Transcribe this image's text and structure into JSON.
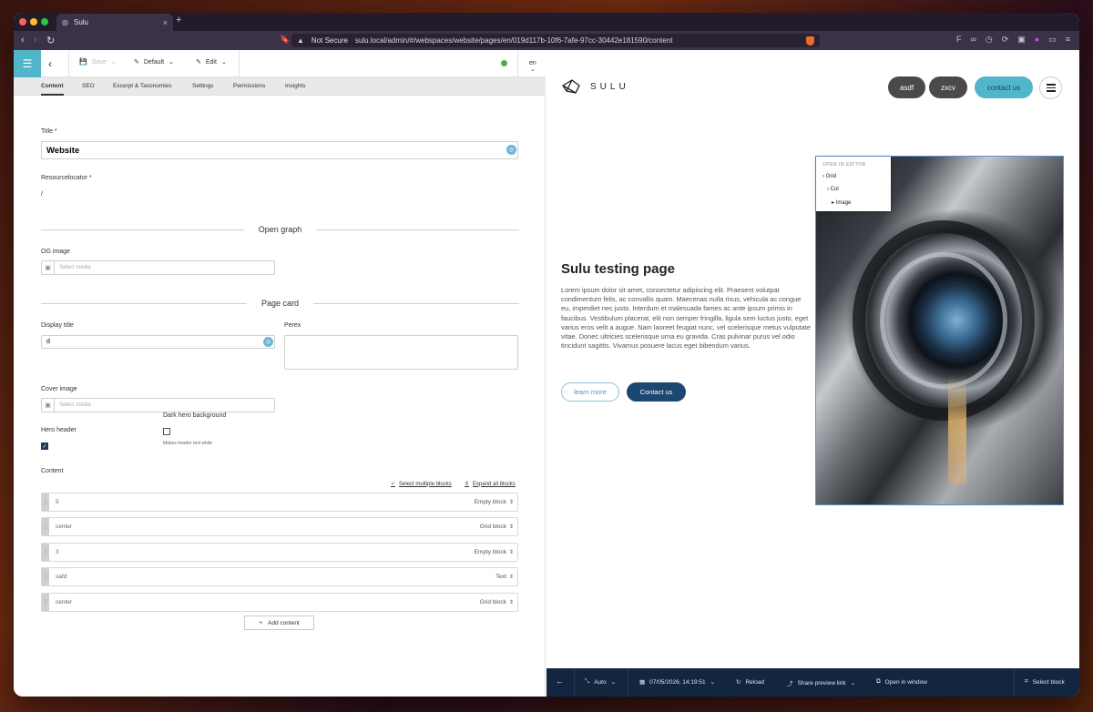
{
  "browser": {
    "tab_title": "Sulu",
    "not_secure": "Not Secure",
    "url": "sulu.local/admin/#/webspaces/website/pages/en/019d117b-10f6-7afe-97cc-30442e181590/content",
    "traffic_colors": [
      "#fe5f57",
      "#febc2e",
      "#28c840"
    ]
  },
  "toolbar": {
    "save_label": "Save",
    "template_label": "Default",
    "edit_label": "Edit",
    "locale": "en"
  },
  "tabs": [
    "Content",
    "SEO",
    "Excerpt & Taxonomies",
    "Settings",
    "Permissions",
    "Insights"
  ],
  "form": {
    "title_label": "Title *",
    "title_value": "Website",
    "resourcelocator_label": "Resourcelocator *",
    "resourcelocator_value": "/",
    "open_graph_title": "Open graph",
    "og_image_label": "OG image",
    "select_media": "Select media",
    "page_card_title": "Page card",
    "display_title_label": "Display title",
    "display_title_value": "d",
    "perex_label": "Perex",
    "cover_image_label": "Cover image",
    "dark_hero_label": "Dark hero background",
    "dark_hero_hint": "Makes header text white",
    "hero_header_label": "Hero header",
    "content_label": "Content",
    "select_multiple": "Select multiple blocks",
    "expand_all": "Expand all blocks",
    "add_content": "Add content",
    "blocks": [
      {
        "name": "5",
        "type": "Empty block"
      },
      {
        "name": "center",
        "type": "Grid block"
      },
      {
        "name": "3",
        "type": "Empty block"
      },
      {
        "name": "safd",
        "type": "Text"
      },
      {
        "name": "center",
        "type": "Grid block"
      }
    ]
  },
  "preview": {
    "logo_text": "SULU",
    "nav_buttons": [
      "asdf",
      "zxcv"
    ],
    "contact_button": "contact us",
    "hero_title": "Sulu testing page",
    "hero_text": "Lorem ipsum dolor sit amet, consectetur adipiscing elit. Praesent volutpat condimentum felis, ac convallis quam. Maecenas nulla risus, vehicula ac congue eu, imperdiet nec justo. Interdum et malesuada fames ac ante ipsum primis in faucibus. Vestibulum placerat, elit non semper fringilla, ligula sem luctus justo, eget varius eros velit a augue. Nam laoreet feugiat nunc, vel scelerisque metus vulputate vitae. Donec ultricies scelerisque urna eu gravida. Cras pulvinar purus vel odio tincidunt sagittis. Vivamus posuere lacus eget bibendum varius.",
    "learn_more": "learn more",
    "contact_us": "Contact us",
    "editor_popup": {
      "header": "OPEN IN EDITOR",
      "items": [
        "Grid",
        "Col",
        "Image"
      ]
    }
  },
  "preview_toolbar": {
    "auto": "Auto",
    "date": "07/05/2026, 14:19:51",
    "reload": "Reload",
    "share": "Share preview link",
    "open_window": "Open in window",
    "select_block": "Select block"
  },
  "colors": {
    "accent": "#52b6ca",
    "primary_dark": "#1b4770",
    "toolbar_bg": "#122640"
  }
}
